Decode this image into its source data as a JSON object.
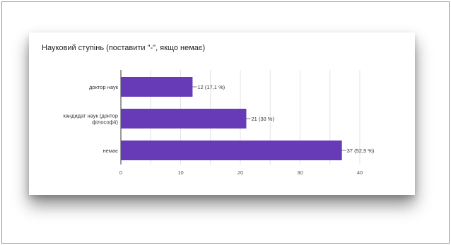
{
  "chart_data": {
    "type": "bar",
    "orientation": "horizontal",
    "title": "Науковий ступінь  (поставити \"-\", якщо немає)",
    "categories": [
      [
        "доктор наук"
      ],
      [
        "кандидат наук (доктор",
        "філософії)"
      ],
      [
        "немає"
      ]
    ],
    "values": [
      12,
      21,
      37
    ],
    "data_labels": [
      "12 (17,1 %)",
      "21 (30 %)",
      "37 (52,9 %)"
    ],
    "xticks": [
      "0",
      "10",
      "20",
      "30",
      "40"
    ],
    "xlim": [
      0,
      40
    ],
    "grid": true,
    "bar_color": "#673ab7",
    "xlabel": "",
    "ylabel": ""
  }
}
